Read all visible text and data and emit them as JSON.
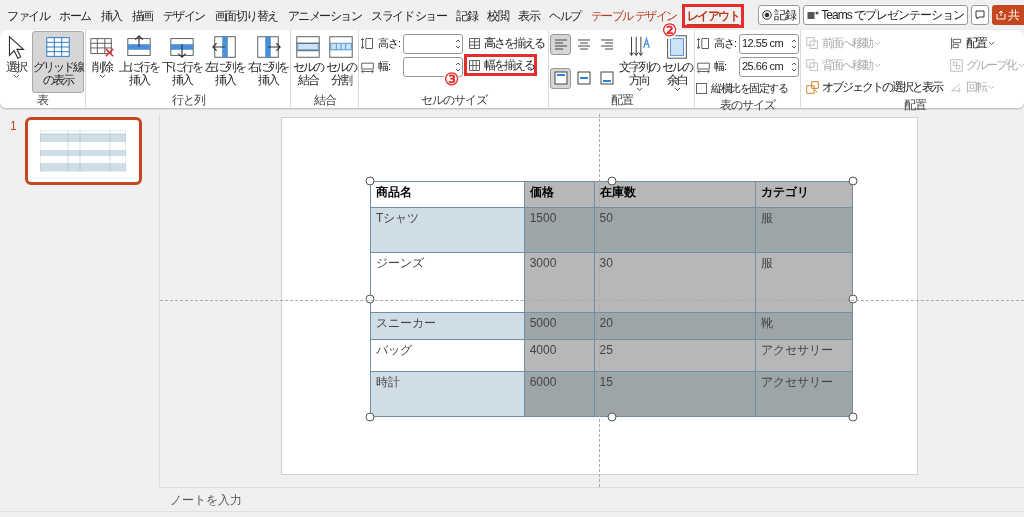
{
  "tabs": [
    {
      "label": "ファイル",
      "selected": false,
      "contextual": false,
      "highlighted": false
    },
    {
      "label": "ホーム",
      "selected": false,
      "contextual": false,
      "highlighted": false
    },
    {
      "label": "挿入",
      "selected": false,
      "contextual": false,
      "highlighted": false
    },
    {
      "label": "描画",
      "selected": false,
      "contextual": false,
      "highlighted": false
    },
    {
      "label": "デザイン",
      "selected": false,
      "contextual": false,
      "highlighted": false
    },
    {
      "label": "画面切り替え",
      "selected": false,
      "contextual": false,
      "highlighted": false
    },
    {
      "label": "アニメーション",
      "selected": false,
      "contextual": false,
      "highlighted": false
    },
    {
      "label": "スライド ショー",
      "selected": false,
      "contextual": false,
      "highlighted": false
    },
    {
      "label": "記録",
      "selected": false,
      "contextual": false,
      "highlighted": false
    },
    {
      "label": "校閲",
      "selected": false,
      "contextual": false,
      "highlighted": false
    },
    {
      "label": "表示",
      "selected": false,
      "contextual": false,
      "highlighted": false
    },
    {
      "label": "ヘルプ",
      "selected": false,
      "contextual": false,
      "highlighted": false
    },
    {
      "label": "テーブル デザイン",
      "selected": false,
      "contextual": true,
      "highlighted": false
    },
    {
      "label": "レイアウト",
      "selected": true,
      "contextual": true,
      "highlighted": true,
      "callout": "②"
    }
  ],
  "top_buttons": [
    {
      "kind": "record",
      "label": "記録"
    },
    {
      "kind": "teams",
      "label": "Teams でプレゼンテーション"
    },
    {
      "kind": "comment"
    },
    {
      "kind": "share",
      "label": "共"
    }
  ],
  "ribbon": [
    {
      "label": "表",
      "columns": [
        {
          "kind": "large",
          "lines": [
            "選択"
          ],
          "dropdown": true,
          "pressed": false
        },
        {
          "kind": "large",
          "lines": [
            "グリッド線",
            "の表示"
          ],
          "dropdown": false,
          "pressed": true
        }
      ]
    },
    {
      "label": "行と列",
      "columns": [
        {
          "kind": "large",
          "lines": [
            "削除"
          ],
          "dropdown": true,
          "pressed": false
        },
        {
          "kind": "large",
          "lines": [
            "上に行を",
            "挿入"
          ],
          "dropdown": false,
          "pressed": false
        },
        {
          "kind": "large",
          "lines": [
            "下に行を",
            "挿入"
          ],
          "dropdown": false,
          "pressed": false
        },
        {
          "kind": "large",
          "lines": [
            "左に列を",
            "挿入"
          ],
          "dropdown": false,
          "pressed": false
        },
        {
          "kind": "large",
          "lines": [
            "右に列を",
            "挿入"
          ],
          "dropdown": false,
          "pressed": false
        }
      ]
    },
    {
      "label": "結合",
      "columns": [
        {
          "kind": "large",
          "lines": [
            "セルの",
            "結合"
          ],
          "dropdown": false,
          "pressed": false
        },
        {
          "kind": "large",
          "lines": [
            "セルの",
            "分割"
          ],
          "dropdown": false,
          "pressed": false
        }
      ]
    },
    {
      "label": "セルのサイズ",
      "columns": [
        {
          "kind": "stack",
          "items": [
            {
              "kind": "spin",
              "label": "高さ:",
              "value": ""
            },
            {
              "kind": "spin",
              "label": "幅:",
              "value": ""
            }
          ]
        },
        {
          "kind": "stack",
          "items": [
            {
              "kind": "small",
              "label": "高さを揃える",
              "disabled": false,
              "dropdown": false,
              "highlighted": false
            },
            {
              "kind": "small",
              "label": "幅を揃える",
              "disabled": false,
              "dropdown": false,
              "highlighted": true,
              "callout": "③"
            }
          ]
        }
      ]
    },
    {
      "label": "配置",
      "columns": [
        {
          "kind": "align",
          "buttons": [
            {
              "selected": true
            },
            {
              "selected": false
            },
            {
              "selected": false
            },
            {
              "selected": true
            },
            {
              "selected": false
            },
            {
              "selected": false
            }
          ]
        },
        {
          "kind": "large",
          "lines": [
            "文字列の",
            "方向"
          ],
          "dropdown": true,
          "pressed": false
        },
        {
          "kind": "large",
          "lines": [
            "セルの",
            "余白"
          ],
          "dropdown": true,
          "pressed": false
        }
      ]
    },
    {
      "label": "表のサイズ",
      "columns": [
        {
          "kind": "stack",
          "items": [
            {
              "kind": "spin",
              "label": "高さ:",
              "value": "12.55 cm"
            },
            {
              "kind": "spin",
              "label": "幅:",
              "value": "25.66 cm"
            },
            {
              "kind": "check",
              "label": "縦横比を固定する",
              "checked": false
            }
          ]
        }
      ]
    },
    {
      "label": "配置",
      "columns": [
        {
          "kind": "stack",
          "items": [
            {
              "kind": "small",
              "label": "前面へ移動",
              "disabled": true,
              "dropdown": true,
              "highlighted": false
            },
            {
              "kind": "small",
              "label": "背面へ移動",
              "disabled": true,
              "dropdown": true,
              "highlighted": false
            },
            {
              "kind": "small",
              "label": "オブジェクトの選択と表示",
              "disabled": false,
              "dropdown": false,
              "highlighted": false
            }
          ]
        },
        {
          "kind": "stack",
          "items": [
            {
              "kind": "small",
              "label": "配置",
              "disabled": false,
              "dropdown": true,
              "highlighted": false
            },
            {
              "kind": "small",
              "label": "グループ化",
              "disabled": true,
              "dropdown": true,
              "highlighted": false
            },
            {
              "kind": "small",
              "label": "回転",
              "disabled": true,
              "dropdown": true,
              "highlighted": false
            }
          ]
        }
      ]
    }
  ],
  "slides": [
    {
      "number": "1",
      "selected": true
    }
  ],
  "table": {
    "columns": [
      {
        "header": "商品名",
        "selected": false
      },
      {
        "header": "価格",
        "selected": true
      },
      {
        "header": "在庫数",
        "selected": true
      },
      {
        "header": "カテゴリ",
        "selected": true
      }
    ],
    "rows": [
      {
        "banded": true,
        "cells": [
          "Tシャツ",
          "1500",
          "50",
          "服"
        ]
      },
      {
        "banded": false,
        "cells": [
          "ジーンズ",
          "3000",
          "30",
          "服"
        ]
      },
      {
        "banded": true,
        "cells": [
          "スニーカー",
          "5000",
          "20",
          "靴"
        ]
      },
      {
        "banded": false,
        "cells": [
          "バッグ",
          "4000",
          "25",
          "アクセサリー"
        ]
      },
      {
        "banded": true,
        "cells": [
          "時計",
          "6000",
          "15",
          "アクセサリー"
        ]
      }
    ]
  },
  "notes": {
    "placeholder": "ノートを入力"
  }
}
